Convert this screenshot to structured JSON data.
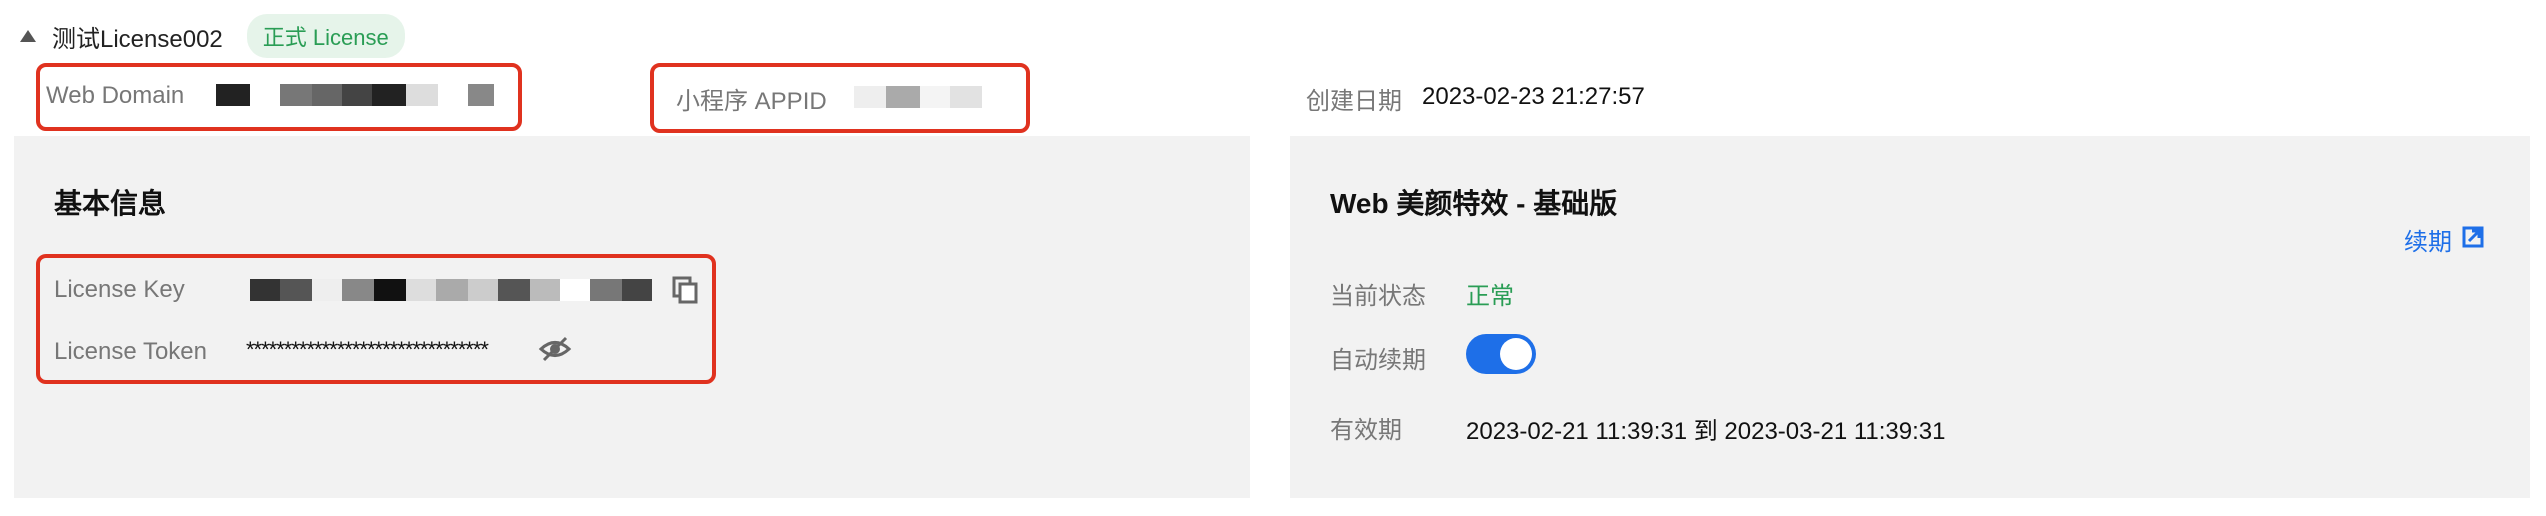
{
  "license": {
    "name": "测试License002",
    "badge": "正式 License"
  },
  "top_fields": {
    "web_domain_label": "Web Domain",
    "appid_label": "小程序 APPID",
    "created_label": "创建日期",
    "created_value": "2023-02-23 21:27:57"
  },
  "basic": {
    "title": "基本信息",
    "license_key_label": "License Key",
    "license_token_label": "License Token",
    "license_token_value": "********************************"
  },
  "product": {
    "title": "Web 美颜特效 - 基础版",
    "renew_label": "续期",
    "status_label": "当前状态",
    "status_value": "正常",
    "auto_renew_label": "自动续期",
    "validity_label": "有效期",
    "validity_value": "2023-02-21 11:39:31 到 2023-03-21 11:39:31"
  },
  "colors": {
    "accent": "#1e6fe8",
    "highlight_box": "#e0321f",
    "status_ok": "#2a9d55"
  }
}
